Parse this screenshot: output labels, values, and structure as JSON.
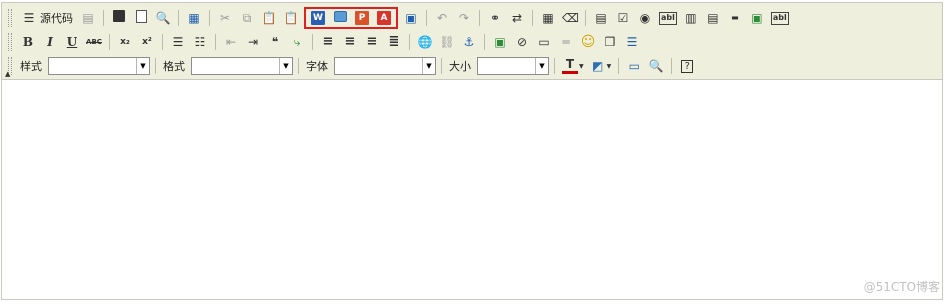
{
  "toolbar": {
    "source_label": "源代码",
    "style_label": "样式",
    "style_value": "",
    "format_label": "格式",
    "format_value": "",
    "font_label": "字体",
    "font_value": "",
    "size_label": "大小",
    "size_value": "",
    "icons": {
      "superscript": "x²",
      "subscript": "x₂",
      "spellcheck": "ABC",
      "bold": "B",
      "italic": "I",
      "underline": "U",
      "word": "W",
      "ppt": "P",
      "pdf": "A",
      "textfield": "abl",
      "radio": "◉",
      "checkbox": "☑"
    }
  },
  "editor": {
    "content": ""
  },
  "watermark": "@51CTO博客",
  "colors": {
    "toolbar_bg": "#efefde",
    "highlight_border": "#e02020"
  }
}
